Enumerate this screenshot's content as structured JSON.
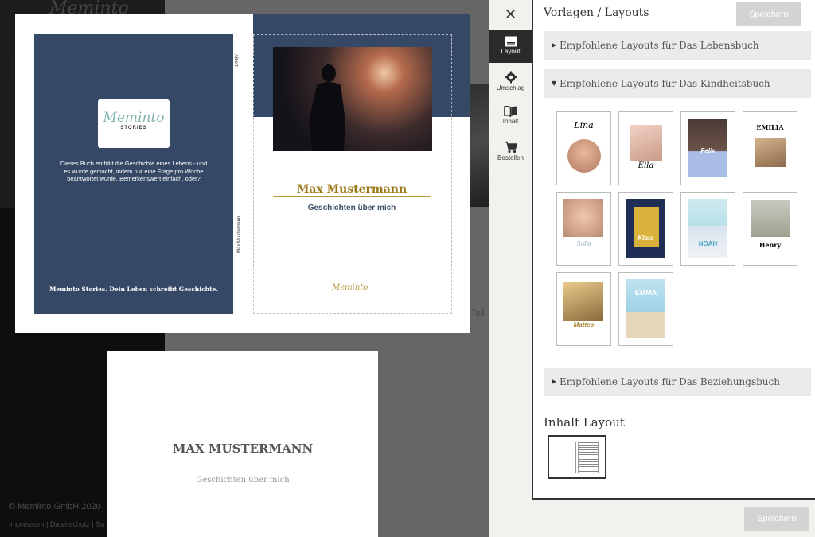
{
  "background": {
    "copyright": "© Meminto GmbH 2020",
    "footer_links": "Impressum | Datenschutz | Su",
    "side_text": "Teil"
  },
  "cover": {
    "back_logo_script": "Meminto",
    "back_logo_sub": "STORIES",
    "back_text": "Dieses Buch enthält die Geschichte eines Lebens - und es wurde gemacht, indem nur eine Frage pro Woche beantwortet wurde. Bemerkenswert einfach, oder?",
    "back_slogan": "Meminto Stories. Dein Leben schreibt Geschichte.",
    "spine_top": "Albert",
    "spine_bottom": "Max Mustermann",
    "front_name": "Max Mustermann",
    "front_subtitle": "Geschichten über mich",
    "front_logo": "Meminto"
  },
  "title_page": {
    "name": "MAX MUSTERMANN",
    "subtitle": "Geschichten über mich"
  },
  "toolbar": {
    "close": "✕",
    "items": [
      {
        "label": "Layout",
        "icon": "layout-icon",
        "active": true
      },
      {
        "label": "Umschlag",
        "icon": "gear-icon",
        "active": false
      },
      {
        "label": "Inhalt",
        "icon": "book-icon",
        "active": false
      },
      {
        "label": "Bestellen",
        "icon": "cart-icon",
        "active": false
      }
    ]
  },
  "panel": {
    "title": "Vorlagen / Layouts",
    "save_label": "Speichern",
    "sections": [
      {
        "label": "Empfohlene Layouts für Das Lebensbuch",
        "expanded": false
      },
      {
        "label": "Empfohlene Layouts für Das Kindheitsbuch",
        "expanded": true
      },
      {
        "label": "Empfohlene Layouts für Das Beziehungsbuch",
        "expanded": false
      }
    ],
    "templates": [
      "Lina",
      "Ella",
      "Felix",
      "EMILIA",
      "Sofia",
      "Klara",
      "NOAH",
      "Henry",
      "Matteo",
      "EMMA"
    ],
    "inhalt_title": "Inhalt Layout"
  },
  "footer": {
    "save_label": "Speichern"
  },
  "colors": {
    "cover_blue": "#354865",
    "gold": "#9c7a1c",
    "toolbar_active": "#2a2a2a"
  }
}
